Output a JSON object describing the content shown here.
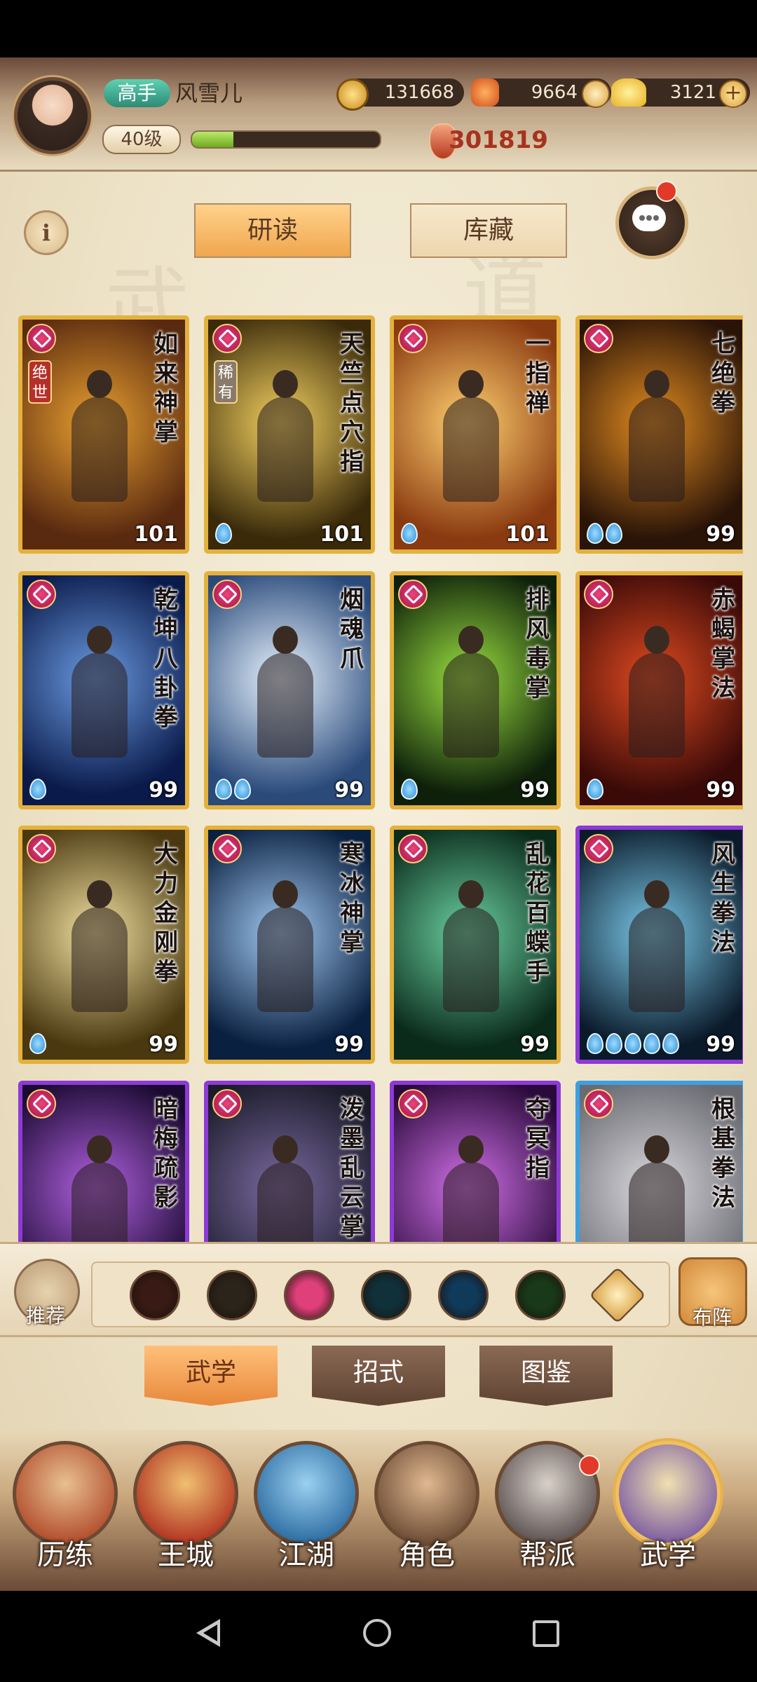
{
  "player": {
    "rank": "高手",
    "name": "风雪儿",
    "level": "40级",
    "xp_fraction": 0.22,
    "power": "301819"
  },
  "resources": {
    "coins": "131668",
    "spirit": "9664",
    "gold": "3121"
  },
  "top_tabs": {
    "study": "研读",
    "collection": "库藏"
  },
  "cards": [
    {
      "name": "如来神掌",
      "level": "101",
      "frame": "gold",
      "tag": "绝世",
      "tag_style": "red",
      "drops": 0,
      "colors": [
        "#5a2a10",
        "#e8a030"
      ]
    },
    {
      "name": "天竺点穴指",
      "level": "101",
      "frame": "gold",
      "tag": "稀有",
      "tag_style": "gray",
      "drops": 1,
      "colors": [
        "#3a2a0a",
        "#f2d060"
      ]
    },
    {
      "name": "一指禅",
      "level": "101",
      "frame": "gold",
      "tag": "",
      "drops": 1,
      "colors": [
        "#8a3a10",
        "#ffd070"
      ]
    },
    {
      "name": "七绝拳",
      "level": "99",
      "frame": "gold",
      "tag": "",
      "drops": 2,
      "colors": [
        "#2a1408",
        "#e08a20"
      ]
    },
    {
      "name": "乾坤八卦拳",
      "level": "99",
      "frame": "gold",
      "tag": "",
      "drops": 1,
      "colors": [
        "#0a1a4a",
        "#6a9ae0"
      ]
    },
    {
      "name": "烟魂爪",
      "level": "99",
      "frame": "gold",
      "tag": "",
      "drops": 2,
      "colors": [
        "#2a4a7a",
        "#e8f4ff"
      ]
    },
    {
      "name": "排风毒掌",
      "level": "99",
      "frame": "gold",
      "tag": "",
      "drops": 1,
      "colors": [
        "#0e200a",
        "#9ae040"
      ]
    },
    {
      "name": "赤蝎掌法",
      "level": "99",
      "frame": "gold",
      "tag": "",
      "drops": 1,
      "colors": [
        "#3a0a08",
        "#e04a20"
      ]
    },
    {
      "name": "大力金刚拳",
      "level": "99",
      "frame": "gold",
      "tag": "",
      "drops": 1,
      "colors": [
        "#4a3810",
        "#f0e0a0"
      ]
    },
    {
      "name": "寒冰神掌",
      "level": "99",
      "frame": "gold",
      "tag": "",
      "drops": 0,
      "colors": [
        "#0a2040",
        "#a0c8f0"
      ]
    },
    {
      "name": "乱花百蝶手",
      "level": "99",
      "frame": "gold",
      "tag": "",
      "drops": 0,
      "colors": [
        "#0a2a1a",
        "#6ad0a0"
      ]
    },
    {
      "name": "风生拳法",
      "level": "99",
      "frame": "purple",
      "tag": "",
      "drops": 5,
      "colors": [
        "#0a1a2a",
        "#7ac8e8"
      ]
    },
    {
      "name": "暗梅疏影",
      "level": "",
      "frame": "purple",
      "tag": "",
      "drops": 0,
      "colors": [
        "#1a0a30",
        "#b060e0"
      ]
    },
    {
      "name": "泼墨乱云掌",
      "level": "",
      "frame": "purple",
      "tag": "",
      "drops": 0,
      "colors": [
        "#1a1a28",
        "#7a6aa0"
      ]
    },
    {
      "name": "夺冥指",
      "level": "",
      "frame": "purple",
      "tag": "",
      "drops": 0,
      "colors": [
        "#2a0a3a",
        "#d070e8"
      ]
    },
    {
      "name": "根基拳法",
      "level": "",
      "frame": "blue",
      "tag": "",
      "drops": 0,
      "colors": [
        "#6a6a72",
        "#d8d8dc"
      ]
    }
  ],
  "filter_bar": {
    "recommend_label": "推荐",
    "layout_label": "布阵",
    "icons": [
      "sword-school-icon",
      "blade-school-icon",
      "palm-school-icon",
      "fist-school-icon",
      "taiji-school-icon",
      "poison-school-icon",
      "collapse-arrow-icon"
    ]
  },
  "sub_tabs": {
    "martial": "武学",
    "moves": "招式",
    "codex": "图鉴"
  },
  "nav": {
    "items": [
      {
        "label": "历练",
        "icon": "training-icon"
      },
      {
        "label": "王城",
        "icon": "palace-icon"
      },
      {
        "label": "江湖",
        "icon": "jianghu-icon"
      },
      {
        "label": "角色",
        "icon": "character-icon"
      },
      {
        "label": "帮派",
        "icon": "guild-icon"
      },
      {
        "label": "武学",
        "icon": "scrolls-icon"
      }
    ],
    "active": 5
  },
  "colors": {
    "gold_frame": "#e4b13d",
    "purple_frame": "#8d3ad6",
    "blue_frame": "#3aa0e4",
    "active_tab": "#f0a64e"
  }
}
